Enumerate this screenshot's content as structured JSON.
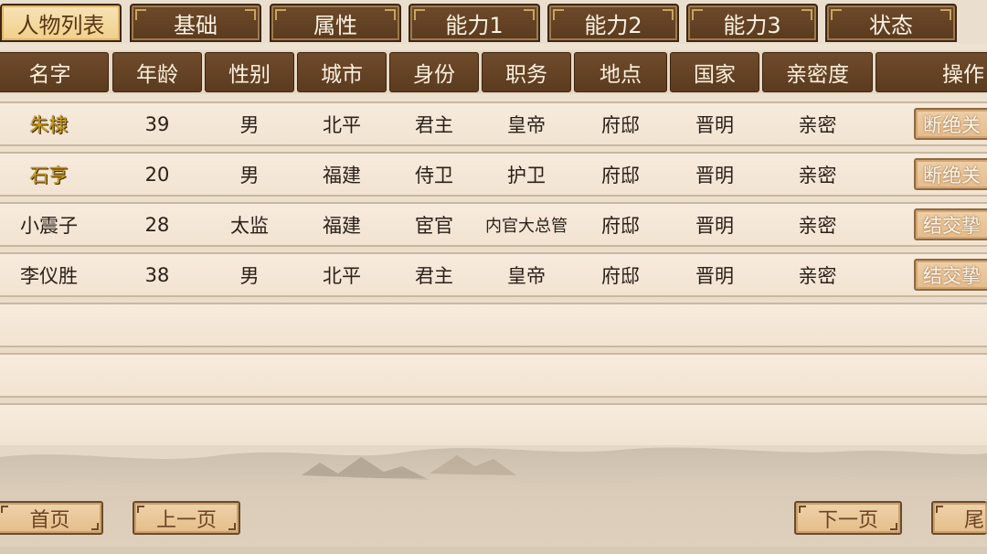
{
  "tabs": [
    {
      "label": "人物列表",
      "active": true
    },
    {
      "label": "基础",
      "active": false
    },
    {
      "label": "属性",
      "active": false
    },
    {
      "label": "能力1",
      "active": false
    },
    {
      "label": "能力2",
      "active": false
    },
    {
      "label": "能力3",
      "active": false
    },
    {
      "label": "状态",
      "active": false
    }
  ],
  "columns": [
    "名字",
    "年龄",
    "性别",
    "城市",
    "身份",
    "职务",
    "地点",
    "国家",
    "亲密度",
    "操作"
  ],
  "rows": [
    {
      "name": "朱棣",
      "age": "39",
      "gender": "男",
      "city": "北平",
      "identity": "君主",
      "post": "皇帝",
      "location": "府邸",
      "country": "晋明",
      "intimacy": "亲密",
      "action": "断绝关",
      "highlight": true
    },
    {
      "name": "石亨",
      "age": "20",
      "gender": "男",
      "city": "福建",
      "identity": "侍卫",
      "post": "护卫",
      "location": "府邸",
      "country": "晋明",
      "intimacy": "亲密",
      "action": "断绝关",
      "highlight": true
    },
    {
      "name": "小震子",
      "age": "28",
      "gender": "太监",
      "city": "福建",
      "identity": "宦官",
      "post": "内官大总管",
      "location": "府邸",
      "country": "晋明",
      "intimacy": "亲密",
      "action": "结交挚",
      "highlight": false
    },
    {
      "name": "李仪胜",
      "age": "38",
      "gender": "男",
      "city": "北平",
      "identity": "君主",
      "post": "皇帝",
      "location": "府邸",
      "country": "晋明",
      "intimacy": "亲密",
      "action": "结交挚",
      "highlight": false
    }
  ],
  "pager": {
    "first": "首页",
    "prev": "上一页",
    "next": "下一页",
    "last": "尾"
  },
  "colors": {
    "tab_bg": "#5f3f22",
    "tab_active_bg": "#f3d595",
    "header_bg": "#64442a",
    "row_bg": "#f4e6d6",
    "name_highlight": "#c89b15"
  }
}
